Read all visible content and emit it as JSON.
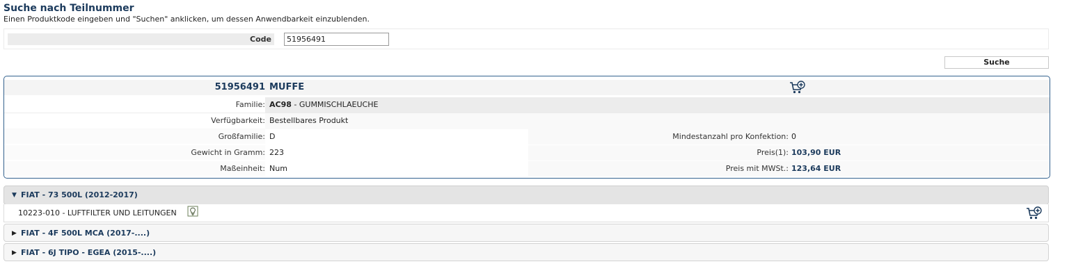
{
  "header": {
    "title": "Suche nach Teilnummer",
    "subtitle": "Einen Produktkode eingeben und \"Suchen\" anklicken, um dessen Anwendbarkeit einzublenden."
  },
  "search": {
    "code_label": "Code",
    "code_value": "51956491",
    "button_label": "Suche"
  },
  "part": {
    "number": "51956491",
    "name": "MUFFE",
    "familie_label": "Familie:",
    "familie_code": "AC98",
    "familie_desc": " - GUMMISCHLAEUCHE",
    "verfuegbarkeit_label": "Verfügbarkeit:",
    "verfuegbarkeit_value": "Bestellbares Produkt",
    "grossfamilie_label": "Großfamilie:",
    "grossfamilie_value": "D",
    "gewicht_label": "Gewicht in Gramm:",
    "gewicht_value": "223",
    "masseinheit_label": "Maßeinheit:",
    "masseinheit_value": "Num",
    "mindestanzahl_label": "Mindestanzahl pro Konfektion:",
    "mindestanzahl_value": "0",
    "preis_label": "Preis(1):",
    "preis_value": "103,90 EUR",
    "preis_mwst_label": "Preis mit MWSt.:",
    "preis_mwst_value": "123,64 EUR"
  },
  "applicability": [
    {
      "label": "FIAT - 73 500L (2012-2017)",
      "expanded": true,
      "items": [
        "10223-010 - LUFTFILTER UND LEITUNGEN"
      ]
    },
    {
      "label": "FIAT - 4F 500L MCA (2017-....)",
      "expanded": false
    },
    {
      "label": "FIAT - 6J TIPO - EGEA (2015-....)",
      "expanded": false
    }
  ],
  "icons": {
    "cart_add": "cart-add-icon",
    "bulb": "info-bulb-icon",
    "expanded_arrow": "triangle-down-icon",
    "collapsed_arrow": "triangle-right-icon"
  },
  "colors": {
    "accent": "#1b3a5c",
    "box_border": "#34628e"
  }
}
